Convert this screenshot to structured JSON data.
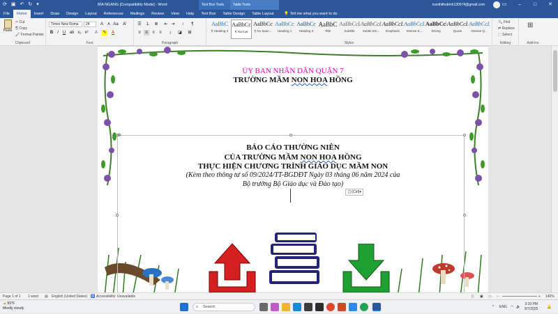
{
  "titlebar": {
    "doc_title": "BÌA NGANG [Compatibility Mode]  -  Word",
    "ctx_text_box_tools": "Text Box Tools",
    "ctx_table_tools": "Table Tools",
    "account": "tranthithutrinh130574@gmail.com"
  },
  "tabs": [
    "File",
    "Home",
    "Insert",
    "Draw",
    "Design",
    "Layout",
    "References",
    "Mailings",
    "Review",
    "View",
    "Help",
    "Text Box",
    "Table Design",
    "Table Layout"
  ],
  "tell_me": "Tell me what you want to do",
  "ribbon": {
    "clipboard": {
      "paste": "Paste",
      "cut": "Cut",
      "copy": "Copy",
      "format_painter": "Format Painter",
      "label": "Clipboard"
    },
    "font": {
      "name": "Times New Roma",
      "size": "24",
      "label": "Font"
    },
    "paragraph": {
      "label": "Paragraph"
    },
    "styles": {
      "label": "Styles",
      "items": [
        {
          "preview": "AaBbC",
          "name": "¶ Heading 2"
        },
        {
          "preview": "AaBbCc",
          "name": "¶ Normal"
        },
        {
          "preview": "AaBbCc",
          "name": "¶ No Spac..."
        },
        {
          "preview": "AaBbCc",
          "name": "Heading 1"
        },
        {
          "preview": "AaBbCc",
          "name": "Heading 3"
        },
        {
          "preview": "AaBbC",
          "name": "Title"
        },
        {
          "preview": "AaBbCcD",
          "name": "Subtitle"
        },
        {
          "preview": "AaBbCcL",
          "name": "Subtle Em..."
        },
        {
          "preview": "AaBbCcL",
          "name": "Emphasis"
        },
        {
          "preview": "AaBbCcL",
          "name": "Intense E..."
        },
        {
          "preview": "AaBbCcL",
          "name": "Strong"
        },
        {
          "preview": "AaBbCcL",
          "name": "Quote"
        },
        {
          "preview": "AaBbCcL",
          "name": "Intense Q..."
        }
      ]
    },
    "editing": {
      "find": "Find",
      "replace": "Replace",
      "select": "Select",
      "label": "Editing"
    },
    "addins": {
      "label": "Add-ins"
    }
  },
  "document": {
    "line1": "ỦY BAN NHÂN DÂN QUẬN 7",
    "line2_pre": "TRƯỜNG MẦM ",
    "line2_squig": "NON HOA",
    "line2_post": " HỒNG",
    "line3": "BÁO CÁO THƯỜNG NIÊN",
    "line4_pre": "CỦA TRƯỜNG MẦM ",
    "line4_squig": "NON HOA",
    "line4_post": " HỒNG",
    "line5": "THỰC HIỆN CHƯƠNG TRÌNH GIÁO DỤC MẦM NON",
    "line6": "(Kèm theo thông tư số 09/2024/TT-BGDĐT Ngày 03 tháng 06 năm 2024 của",
    "line7": "Bộ trưởng Bộ Giáo dục và Đào tạo)",
    "paste_option": "(Ctrl)"
  },
  "statusbar": {
    "page": "Page 1 of 1",
    "words": "1 word",
    "language": "English (United States)",
    "accessibility": "Accessibility: Unavailable",
    "zoom": "140%"
  },
  "taskbar": {
    "weather_temp": "93°F",
    "weather_desc": "Mostly cloudy",
    "search": "Search",
    "lang": "ENG",
    "time": "3:10 PM",
    "date": "5/7/2025"
  },
  "colors": {
    "word_blue": "#2b579a",
    "heading_magenta": "#e600c8",
    "upload_red": "#d42020",
    "download_green": "#1fa032",
    "books_navy": "#23237a"
  }
}
